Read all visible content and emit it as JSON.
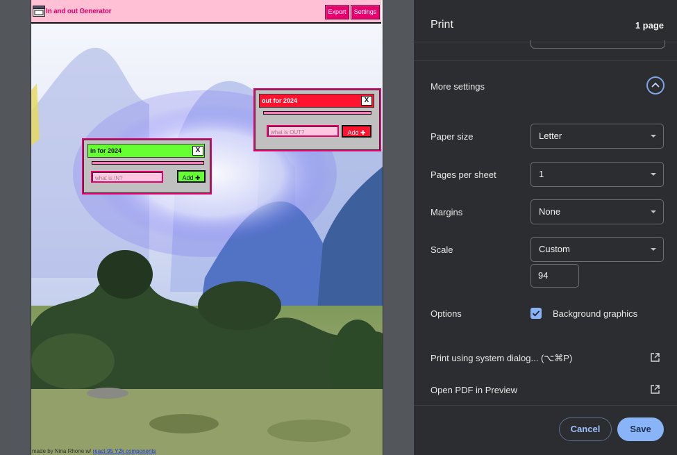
{
  "preview": {
    "app_title": "In and out Generator",
    "export_label": "Export",
    "settings_label": "Settings",
    "in_window": {
      "title": "in for 2024",
      "close_label": "X",
      "placeholder": "what is IN?",
      "add_label": "Add",
      "add_glyph": "✚",
      "accent": "#66ff33"
    },
    "out_window": {
      "title": "out for 2024",
      "close_label": "X",
      "placeholder": "what is OUT?",
      "add_label": "Add",
      "add_glyph": "✚",
      "accent": "#ff1430"
    },
    "credit_prefix": "made by Nina Rhone w/",
    "credit_link": "react-95 Y2k components"
  },
  "print_panel": {
    "title": "Print",
    "page_count": "1 page",
    "more_settings": "More settings",
    "paper_size": {
      "label": "Paper size",
      "value": "Letter"
    },
    "pages_per_sheet": {
      "label": "Pages per sheet",
      "value": "1"
    },
    "margins": {
      "label": "Margins",
      "value": "None"
    },
    "scale": {
      "label": "Scale",
      "value": "Custom",
      "custom_value": "94"
    },
    "options": {
      "label": "Options",
      "checkbox_label": "Background graphics",
      "checked": true
    },
    "system_dialog": "Print using system dialog... (⌥⌘P)",
    "open_pdf": "Open PDF in Preview",
    "cancel": "Cancel",
    "save": "Save"
  },
  "colors": {
    "accent_blue": "#8ab4f8",
    "panel_bg": "#2c2d30",
    "app_pink": "#e8006f"
  }
}
